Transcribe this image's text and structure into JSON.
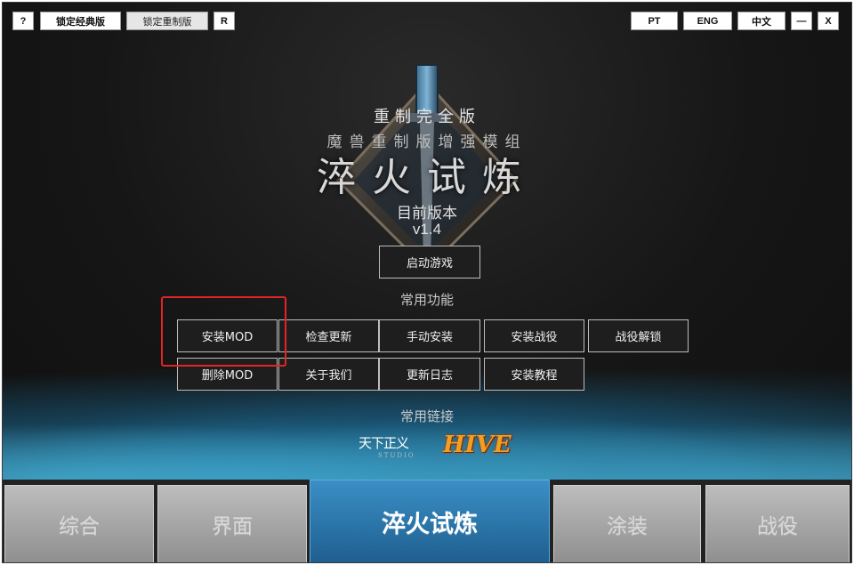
{
  "top_left": {
    "help_label": "?",
    "lock_classic_label": "锁定经典版",
    "lock_reforged_label": "锁定重制版",
    "r_label": "R"
  },
  "top_right": {
    "pt_label": "PT",
    "eng_label": "ENG",
    "zh_label": "中文",
    "minimize_label": "—",
    "close_label": "X"
  },
  "header": {
    "line1": "重制完全版",
    "line2": "魔兽重制版增强模组",
    "title": "淬火试炼",
    "version_label": "目前版本",
    "version": "v1.4"
  },
  "launch_label": "启动游戏",
  "functions": {
    "title": "常用功能",
    "row1": [
      "安装MOD",
      "检查更新",
      "手动安装",
      "安装战役",
      "战役解锁"
    ],
    "row2": [
      "删除MOD",
      "关于我们",
      "更新日志",
      "安装教程"
    ]
  },
  "links": {
    "title": "常用链接",
    "logo1_text": "天下正义",
    "logo1_sub": "STUDIO",
    "logo2_text": "HIVE"
  },
  "tabs": [
    "综合",
    "界面",
    "淬火试炼",
    "涂装",
    "战役"
  ],
  "colors": {
    "accent_tab": "#2a78b0",
    "highlight": "#e12424"
  }
}
